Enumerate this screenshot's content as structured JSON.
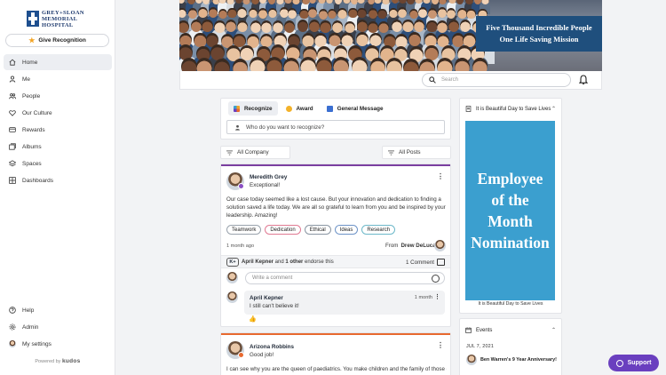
{
  "brand": {
    "logo_text": [
      "GREY+SLOAN",
      "MEMORIAL",
      "HOSPITAL"
    ]
  },
  "sidebar": {
    "give_label": "Give Recognition",
    "items": [
      {
        "label": "Home",
        "icon": "home-icon",
        "active": true
      },
      {
        "label": "Me",
        "icon": "user-icon"
      },
      {
        "label": "People",
        "icon": "people-icon"
      },
      {
        "label": "Our Culture",
        "icon": "heart-icon"
      },
      {
        "label": "Rewards",
        "icon": "card-icon"
      },
      {
        "label": "Albums",
        "icon": "albums-icon"
      },
      {
        "label": "Spaces",
        "icon": "layers-icon"
      },
      {
        "label": "Dashboards",
        "icon": "grid-icon"
      }
    ],
    "bottom_items": [
      {
        "label": "Help",
        "icon": "help-icon"
      },
      {
        "label": "Admin",
        "icon": "gear-icon"
      },
      {
        "label": "My settings",
        "icon": "avatar-icon"
      }
    ],
    "powered_by": "Powered by",
    "powered_brand": "kudos"
  },
  "banner": {
    "line1": "Five Thousand Incredible People",
    "line2": "One Life Saving Mission"
  },
  "search": {
    "placeholder": "Search"
  },
  "composer": {
    "tabs": [
      "Recognize",
      "Award",
      "General Message"
    ],
    "input_placeholder": "Who do you want to recognize?"
  },
  "filters": {
    "left": "All Company",
    "right": "All Posts"
  },
  "posts": [
    {
      "author": "Meredith Grey",
      "subtitle": "Exceptional!",
      "body": "Our case today seemed like a lost cause. But your innovation and dedication to finding a solution saved a life today. We are all so grateful to learn from you and be inspired by your leadership. Amazing!",
      "tags": [
        "Teamwork",
        "Dedication",
        "Ethical",
        "Ideas",
        "Research"
      ],
      "time": "1 month ago",
      "from_label": "From",
      "from_name": "Drew DeLuca",
      "endorse_button": "K+",
      "endorse_name": "April Kepner",
      "endorse_mid": " and ",
      "endorse_other": "1 other",
      "endorse_end": " endorse this",
      "comment_count": "1 Comment",
      "comment_placeholder": "Write a comment",
      "comment": {
        "author": "April Kepner",
        "text": "I still can't believe it!",
        "time": "1 month"
      },
      "accent": "#7b3fa0"
    },
    {
      "author": "Arizona Robbins",
      "subtitle": "Good job!",
      "body": "I can see why you are the queen of paediatrics. You make children and the family of those children",
      "accent": "#e8692f"
    }
  ],
  "right": {
    "card_title": "It is Beautiful Day to Save Lives",
    "poster_lines": [
      "Employee",
      "of the",
      "Month",
      "Nomination"
    ],
    "poster_caption": "It is Beautiful Day to Save Lives",
    "events_title": "Events",
    "event_date": "JUL 7, 2021",
    "event_text": "Ben Warren's 9 Year Anniversary!"
  },
  "support_label": "Support",
  "colors": {
    "accent_purple": "#6a3fbf",
    "poster_blue": "#3b9fcf",
    "banner_navy": "#1f4f7d"
  }
}
